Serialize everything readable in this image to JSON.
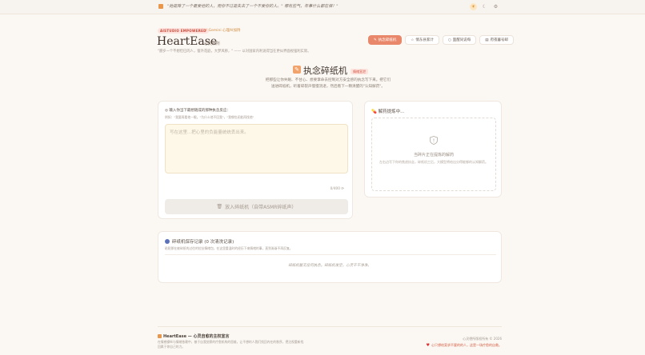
{
  "topbar": {
    "quote": "\"她是降了一个最爱他的人，而你不过是失去了一个不爱你的人。\" 哪有些气，年事什么都在保！\"",
    "icons": [
      "sun-icon",
      "moon-icon",
      "settings-icon"
    ]
  },
  "hero": {
    "badge": "AISTUDIO EMPOWERED",
    "gemini": "⚡ Gemini 心理AI加持",
    "brand": "HeartEase",
    "brand_sub": "心灵栖所",
    "description": "\"愿岁一个不想但已的人，窗外花庭，大梦风移，\" —— 以对国家内利说得当在更似界面视强利实际。"
  },
  "nav": [
    {
      "label": "执念碎纸机",
      "icon": "✎",
      "active": true
    },
    {
      "label": "情东县家计",
      "icon": "☆",
      "active": false
    },
    {
      "label": "面醒同说每",
      "icon": "○",
      "active": false
    },
    {
      "label": "府夜暮号邮",
      "icon": "▤",
      "active": false
    }
  ],
  "section": {
    "icon": "📝",
    "title": "执念碎纸机",
    "tag": "情绪宣泄",
    "description": "把那些让你失眠、不甘心、想要掌命去控制对方安全感的执念写下来。把它们送进碎纸机，听着碎裂声慢慢消退，然后看下一颗清醒的\"认知解药\"。"
  },
  "writer": {
    "label": "◎ 输入你当下最想随成的那种执念反应：",
    "hint": "例如：\"我要再看他一眼。\"为什么他不回我\"，\"我哪些还能再找他\"",
    "placeholder": "写在这里...把心里的负能量统统丢出来。",
    "counter": "0/400 ⟳",
    "shred_icon": "trash-icon",
    "shred_label": "放入碎纸机（自带ASMR碎纸声）"
  },
  "antidote": {
    "title": "💊 解药提炼中...",
    "empty_title": "当碎片正在提炼的解药",
    "empty_desc": "左右边写下你的焦虑执念，碎纸机工后，大模型将给出分得能够的认知解药。"
  },
  "history": {
    "title": "碎纸机保存记录 (0 次清洗记录)",
    "description": "粘贴那在被碎纸的过往的拉扯情绪包，在这里重温时的经历下来情绪的事，直到渐渐不再反复。",
    "empty": "碎纸机暂无任何执念。碎纸机发空，心灵干干净净。"
  },
  "footer": {
    "title": "HeartEase — 心灵自愈的主权宣言",
    "description": "在情感操纵与情绪依赖中，基于自我觉察的疗愈机构的思维，让不想的人我们找回内在的秩序，把注视重新找回属于你自己的力。",
    "copyright": "心灵栖所版权所有 © 2026",
    "slogan": "心只想给案求不要的的人，这是一场疗愈的自救。"
  }
}
